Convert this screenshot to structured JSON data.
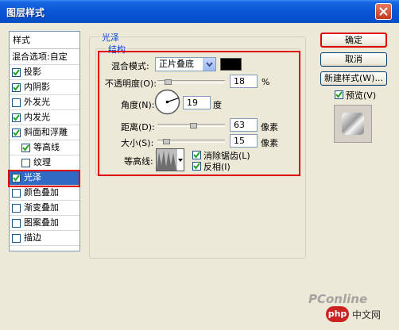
{
  "window": {
    "title": "图层样式",
    "close_icon": "close-icon"
  },
  "styles_panel": {
    "header": "样式",
    "items": [
      {
        "label": "混合选项:自定",
        "checkbox": false,
        "checked": false,
        "indent": 0
      },
      {
        "label": "投影",
        "checkbox": true,
        "checked": true,
        "indent": 0
      },
      {
        "label": "内阴影",
        "checkbox": true,
        "checked": true,
        "indent": 0
      },
      {
        "label": "外发光",
        "checkbox": true,
        "checked": false,
        "indent": 0
      },
      {
        "label": "内发光",
        "checkbox": true,
        "checked": true,
        "indent": 0
      },
      {
        "label": "斜面和浮雕",
        "checkbox": true,
        "checked": true,
        "indent": 0
      },
      {
        "label": "等高线",
        "checkbox": true,
        "checked": true,
        "indent": 1
      },
      {
        "label": "纹理",
        "checkbox": true,
        "checked": false,
        "indent": 1
      },
      {
        "label": "光泽",
        "checkbox": true,
        "checked": true,
        "indent": 0,
        "selected": true
      },
      {
        "label": "颜色叠加",
        "checkbox": true,
        "checked": false,
        "indent": 0
      },
      {
        "label": "渐变叠加",
        "checkbox": true,
        "checked": false,
        "indent": 0
      },
      {
        "label": "图案叠加",
        "checkbox": true,
        "checked": false,
        "indent": 0
      },
      {
        "label": "描边",
        "checkbox": true,
        "checked": false,
        "indent": 0
      }
    ]
  },
  "satin": {
    "group_title": "光泽",
    "structure_title": "结构",
    "blend_mode_label": "混合模式:",
    "blend_mode_value": "正片叠底",
    "blend_color": "#000000",
    "opacity_label": "不透明度(O):",
    "opacity_value": "18",
    "opacity_unit": "%",
    "angle_label": "角度(N):",
    "angle_value": "19",
    "angle_unit": "度",
    "distance_label": "距离(D):",
    "distance_value": "63",
    "distance_unit": "像素",
    "size_label": "大小(S):",
    "size_value": "15",
    "size_unit": "像素",
    "contour_label": "等高线:",
    "antialias_label": "消除锯齿(L)",
    "antialias_checked": true,
    "invert_label": "反相(I)",
    "invert_checked": true
  },
  "buttons": {
    "ok": "确定",
    "cancel": "取消",
    "new_style": "新建样式(W)...",
    "preview_label": "预览(V)",
    "preview_checked": true
  },
  "watermarks": {
    "pconline": "PConline",
    "php": "php",
    "chinese": "中文网"
  },
  "colors": {
    "accent_red": "#e00000",
    "selection_blue": "#316ac5",
    "title_blue": "#0a58d8"
  }
}
